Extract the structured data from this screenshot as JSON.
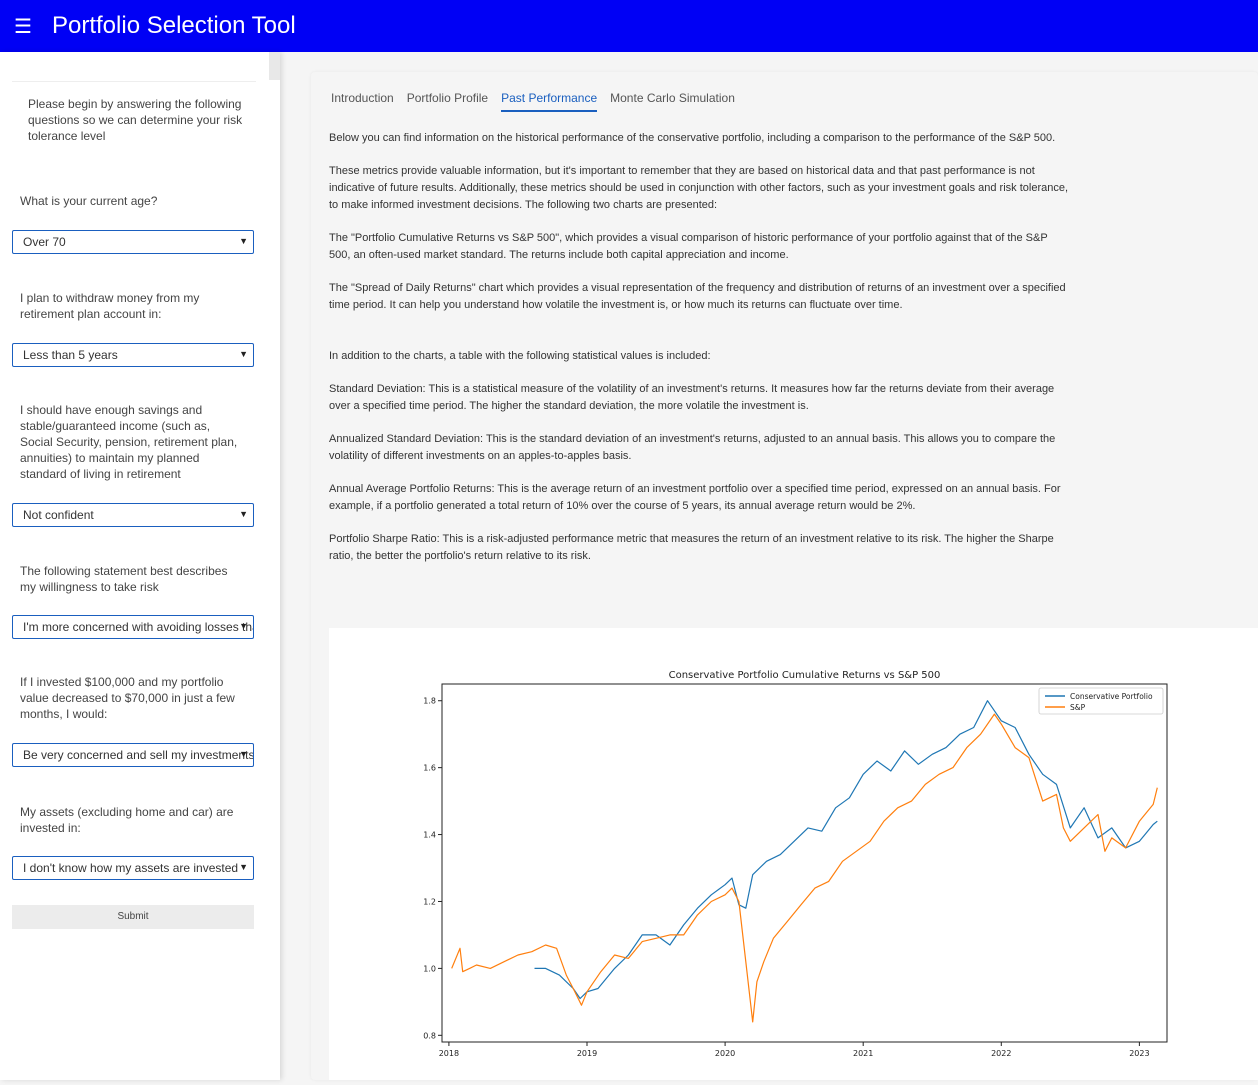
{
  "app": {
    "title": "Portfolio Selection Tool"
  },
  "sidebar": {
    "intro": "Please begin by answering the following questions so we can determine your risk tolerance level",
    "questions": [
      {
        "label": "What is your current age?",
        "selected": "Over 70"
      },
      {
        "label": "I plan to withdraw money from my retirement plan account in:",
        "selected": "Less than 5 years"
      },
      {
        "label": "I should have enough savings and stable/guaranteed income (such as, Social Security, pension, retirement plan, annuities) to maintain my planned standard of living in retirement",
        "selected": "Not confident"
      },
      {
        "label": "The following statement best describes my willingness to take risk",
        "selected": "I'm more concerned with avoiding losses than with making gains"
      },
      {
        "label": "If I invested $100,000 and my portfolio value decreased to $70,000 in just a few months, I would:",
        "selected": "Be very concerned and sell my investments"
      },
      {
        "label": "My assets (excluding home and car) are invested in:",
        "selected": "I don't know how my assets are invested"
      }
    ],
    "submit_label": "Submit"
  },
  "tabs": [
    "Introduction",
    "Portfolio Profile",
    "Past Performance",
    "Monte Carlo Simulation"
  ],
  "active_tab": "Past Performance",
  "content": {
    "paragraphs": [
      "Below you can find information on the historical performance of the conservative portfolio, including a comparison to the performance of the S&P 500.",
      "These metrics provide valuable information, but it's important to remember that they are based on historical data and that past performance is not indicative of future results. Additionally, these metrics should be used in conjunction with other factors, such as your investment goals and risk tolerance, to make informed investment decisions. The following two charts are presented:",
      "The \"Portfolio Cumulative Returns vs S&P 500\", which provides a visual comparison of historic performance of your portfolio against that of the S&P 500, an often-used market standard. The returns include both capital appreciation and income.",
      "The \"Spread of Daily Returns\" chart which provides a visual representation of the frequency and distribution of returns of an investment over a specified time period. It can help you understand how volatile the investment is, or how much its returns can fluctuate over time.",
      "In addition to the charts, a table with the following statistical values is included:",
      "Standard Deviation: This is a statistical measure of the volatility of an investment's returns. It measures how far the returns deviate from their average over a specified time period. The higher the standard deviation, the more volatile the investment is.",
      "Annualized Standard Deviation: This is the standard deviation of an investment's returns, adjusted to an annual basis. This allows you to compare the volatility of different investments on an apples-to-apples basis.",
      "Annual Average Portfolio Returns: This is the average return of an investment portfolio over a specified time period, expressed on an annual basis. For example, if a portfolio generated a total return of 10% over the course of 5 years, its annual average return would be 2%.",
      "Portfolio Sharpe Ratio: This is a risk-adjusted performance metric that measures the return of an investment relative to its risk. The higher the Sharpe ratio, the better the portfolio's return relative to its risk."
    ]
  },
  "colors": {
    "header": "#0000f5",
    "accent": "#1a5fbf",
    "portfolio": "#1f77b4",
    "sp500": "#ff7f0e"
  },
  "chart_data": {
    "type": "line",
    "title": "Conservative Portfolio Cumulative Returns vs S&P 500",
    "xlabel": "",
    "ylabel": "",
    "xlim": [
      2017.95,
      2023.2
    ],
    "ylim": [
      0.78,
      1.85
    ],
    "xticks": [
      2018,
      2019,
      2020,
      2021,
      2022,
      2023
    ],
    "xtick_labels": [
      "2018",
      "2019",
      "2020",
      "2021",
      "2022",
      "2023"
    ],
    "yticks": [
      0.8,
      1.0,
      1.2,
      1.4,
      1.6,
      1.8
    ],
    "ytick_labels": [
      "0.8",
      "1.0",
      "1.2",
      "1.4",
      "1.6",
      "1.8"
    ],
    "legend_position": "top-right",
    "grid": false,
    "series": [
      {
        "name": "Conservative Portfolio",
        "color": "#1f77b4",
        "x": [
          2018.62,
          2018.7,
          2018.8,
          2018.9,
          2018.95,
          2019.0,
          2019.08,
          2019.2,
          2019.3,
          2019.4,
          2019.5,
          2019.6,
          2019.7,
          2019.8,
          2019.9,
          2020.0,
          2020.05,
          2020.1,
          2020.15,
          2020.2,
          2020.3,
          2020.4,
          2020.5,
          2020.6,
          2020.7,
          2020.8,
          2020.9,
          2021.0,
          2021.1,
          2021.2,
          2021.3,
          2021.4,
          2021.5,
          2021.6,
          2021.7,
          2021.8,
          2021.9,
          2022.0,
          2022.1,
          2022.2,
          2022.3,
          2022.4,
          2022.5,
          2022.6,
          2022.7,
          2022.8,
          2022.9,
          2023.0,
          2023.1,
          2023.13
        ],
        "y": [
          1.0,
          1.0,
          0.98,
          0.94,
          0.91,
          0.93,
          0.94,
          1.0,
          1.04,
          1.1,
          1.1,
          1.07,
          1.13,
          1.18,
          1.22,
          1.25,
          1.27,
          1.19,
          1.18,
          1.28,
          1.32,
          1.34,
          1.38,
          1.42,
          1.41,
          1.48,
          1.51,
          1.58,
          1.62,
          1.59,
          1.65,
          1.61,
          1.64,
          1.66,
          1.7,
          1.72,
          1.8,
          1.74,
          1.72,
          1.64,
          1.58,
          1.55,
          1.42,
          1.48,
          1.39,
          1.42,
          1.36,
          1.38,
          1.43,
          1.44
        ]
      },
      {
        "name": "S&P",
        "color": "#ff7f0e",
        "x": [
          2018.02,
          2018.08,
          2018.1,
          2018.15,
          2018.2,
          2018.3,
          2018.4,
          2018.5,
          2018.6,
          2018.7,
          2018.78,
          2018.85,
          2018.9,
          2018.96,
          2019.0,
          2019.1,
          2019.2,
          2019.3,
          2019.4,
          2019.5,
          2019.6,
          2019.7,
          2019.8,
          2019.9,
          2020.0,
          2020.05,
          2020.1,
          2020.15,
          2020.2,
          2020.23,
          2020.28,
          2020.35,
          2020.45,
          2020.55,
          2020.65,
          2020.75,
          2020.85,
          2020.95,
          2021.05,
          2021.15,
          2021.25,
          2021.35,
          2021.45,
          2021.55,
          2021.65,
          2021.75,
          2021.85,
          2021.95,
          2022.0,
          2022.1,
          2022.2,
          2022.3,
          2022.4,
          2022.45,
          2022.5,
          2022.6,
          2022.7,
          2022.75,
          2022.8,
          2022.9,
          2023.0,
          2023.1,
          2023.13
        ],
        "y": [
          1.0,
          1.06,
          0.99,
          1.0,
          1.01,
          1.0,
          1.02,
          1.04,
          1.05,
          1.07,
          1.06,
          0.98,
          0.94,
          0.89,
          0.93,
          0.99,
          1.04,
          1.03,
          1.08,
          1.09,
          1.1,
          1.1,
          1.16,
          1.2,
          1.22,
          1.24,
          1.2,
          1.02,
          0.84,
          0.96,
          1.02,
          1.09,
          1.14,
          1.19,
          1.24,
          1.26,
          1.32,
          1.35,
          1.38,
          1.44,
          1.48,
          1.5,
          1.55,
          1.58,
          1.6,
          1.66,
          1.7,
          1.76,
          1.73,
          1.66,
          1.63,
          1.5,
          1.52,
          1.42,
          1.38,
          1.42,
          1.46,
          1.35,
          1.39,
          1.36,
          1.44,
          1.49,
          1.54
        ]
      }
    ]
  }
}
